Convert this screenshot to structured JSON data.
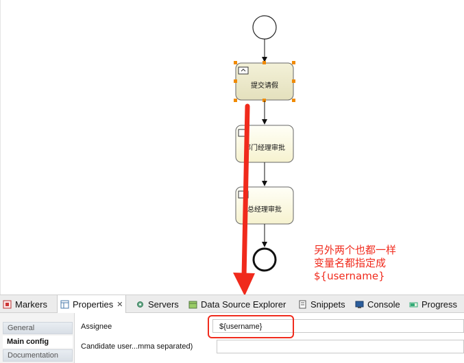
{
  "diagram": {
    "task1_label": "提交请假",
    "task2_label": "部门经理审批",
    "task3_label": "总经理审批"
  },
  "annotation": {
    "lines": [
      "另外两个也都一样",
      "变量名都指定成",
      "${username}"
    ],
    "color": "#f02a1c"
  },
  "tabs": [
    {
      "label": "Markers",
      "icon": "markers-icon"
    },
    {
      "label": "Properties",
      "icon": "properties-icon",
      "active": true
    },
    {
      "label": "Servers",
      "icon": "servers-icon"
    },
    {
      "label": "Data Source Explorer",
      "icon": "data-source-icon"
    },
    {
      "label": "Snippets",
      "icon": "snippets-icon"
    },
    {
      "label": "Console",
      "icon": "console-icon"
    },
    {
      "label": "Progress",
      "icon": "progress-icon"
    }
  ],
  "sidebar": {
    "items": [
      {
        "label": "General"
      },
      {
        "label": "Main config",
        "active": true
      },
      {
        "label": "Documentation"
      }
    ]
  },
  "form": {
    "assignee_label": "Assignee",
    "assignee_value": "${username}",
    "candidate_label": "Candidate user...mma separated)"
  }
}
